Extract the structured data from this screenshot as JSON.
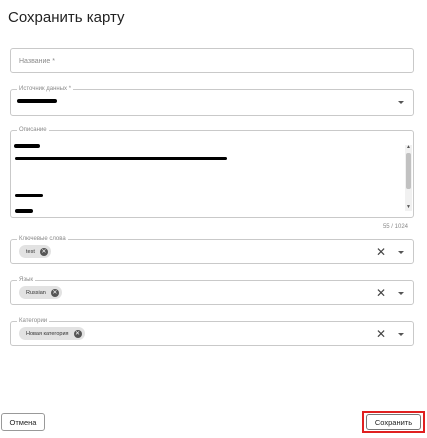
{
  "dialog": {
    "title": "Сохранить карту"
  },
  "fields": {
    "name": {
      "placeholder": "Название *"
    },
    "data_source": {
      "label": "Источник данных *"
    },
    "description": {
      "label": "Описание",
      "counter": "55 / 1024"
    },
    "keywords": {
      "label": "Ключевые слова",
      "chips": [
        "test"
      ]
    },
    "language": {
      "label": "Язык",
      "chips": [
        "Russian"
      ]
    },
    "categories": {
      "label": "Категории",
      "chips": [
        "Новая категория"
      ]
    }
  },
  "icons": {
    "dropdown": "chevron-down-icon",
    "clear": "close-icon",
    "chip_remove": "remove-chip-icon"
  },
  "buttons": {
    "cancel": "Отмена",
    "save": "Сохранить"
  },
  "colors": {
    "highlight": "#e02020",
    "redaction": "#000000",
    "chip_bg": "#e2e2e2"
  }
}
